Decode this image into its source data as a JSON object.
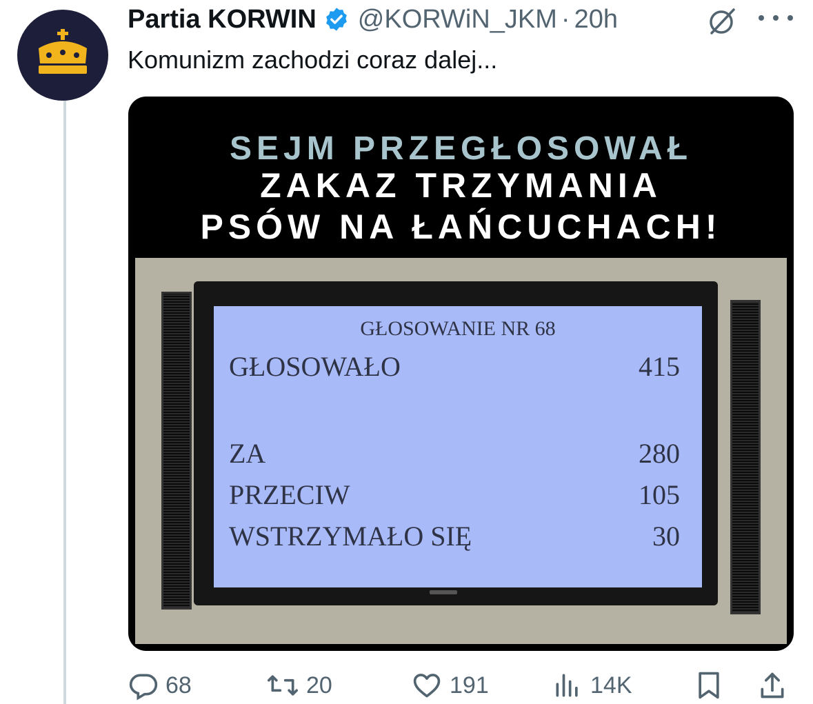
{
  "post": {
    "author": {
      "display_name": "Partia KORWIN",
      "handle": "@KORWiN_JKM",
      "separator": "·",
      "time": "20h",
      "avatar_icon": "crown-icon",
      "verified_icon": "verified-badge-icon"
    },
    "text": "Komunizm zachodzi coraz dalej...",
    "image": {
      "headline_line1": "SEJM PRZEGŁOSOWAŁ",
      "headline_line2": "ZAKAZ TRZYMANIA",
      "headline_line3": "PSÓW NA ŁAŃCUCHACH!",
      "screen": {
        "title": "GŁOSOWANIE NR 68",
        "rows": [
          {
            "label": "GŁOSOWAŁO",
            "value": "415"
          },
          {
            "label": "ZA",
            "value": "280"
          },
          {
            "label": "PRZECIW",
            "value": "105"
          },
          {
            "label": "WSTRZYMAŁO SIĘ",
            "value": "30"
          }
        ]
      }
    },
    "actions": {
      "replies": "68",
      "reposts": "20",
      "likes": "191",
      "views": "14K"
    }
  },
  "colors": {
    "text_primary": "#0f1419",
    "text_secondary": "#536471",
    "verified_blue": "#1d9bf0",
    "thread_line": "#cfd9de",
    "headline_teal": "#a8c4cc",
    "screen_blue": "#a9baf8"
  }
}
